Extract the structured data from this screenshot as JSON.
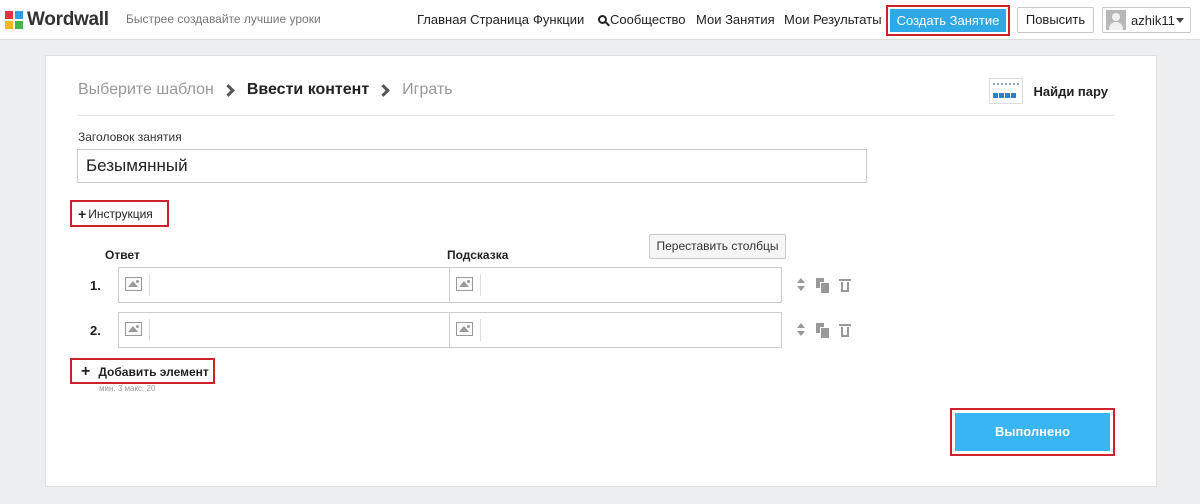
{
  "brand": {
    "name": "Wordwall",
    "tagline": "Быстрее создавайте лучшие уроки",
    "logo_colors": [
      "#e2323c",
      "#2e9fe6",
      "#f6b81c",
      "#45b649"
    ]
  },
  "nav": {
    "home": "Главная Страница",
    "features": "Функции",
    "community": "Сообщество",
    "my_activities": "Мои Занятия",
    "my_results": "Мои Результаты",
    "create": "Создать Занятие",
    "upgrade": "Повысить",
    "username": "azhik11"
  },
  "breadcrumb": {
    "step1": "Выберите шаблон",
    "step2": "Ввести контент",
    "step3": "Играть"
  },
  "template": {
    "name": "Найди пару",
    "icon": "template-thumbnail-icon"
  },
  "activity": {
    "title_label": "Заголовок занятия",
    "title_value": "Безымянный"
  },
  "instruction_button": "Инструкция",
  "swap_columns_button": "Переставить столбцы",
  "columns": {
    "answer": "Ответ",
    "hint": "Подсказка"
  },
  "items": [
    {
      "number": "1.",
      "answer": "",
      "hint": ""
    },
    {
      "number": "2.",
      "answer": "",
      "hint": ""
    }
  ],
  "add_item": {
    "label": "Добавить элемент",
    "limits": "мин. 3   макс. 20"
  },
  "done_button": "Выполнено",
  "colors": {
    "accent": "#2ea9e6",
    "done": "#3ab5f4",
    "highlight": "#d0202e"
  }
}
